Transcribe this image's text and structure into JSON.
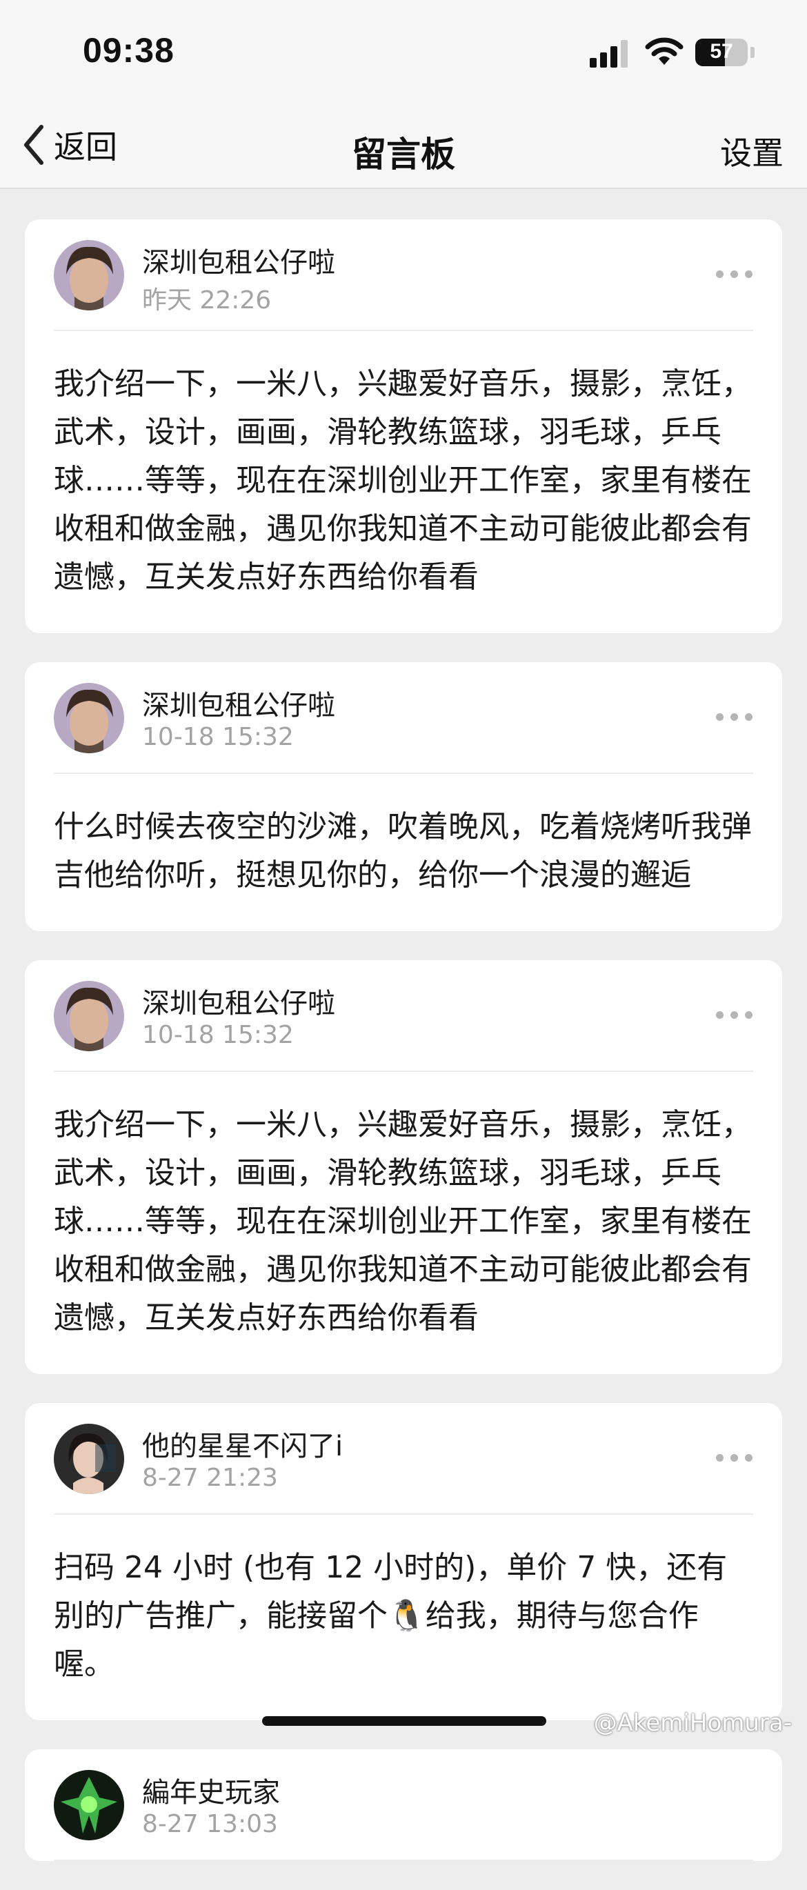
{
  "status": {
    "time": "09:38",
    "battery": "57",
    "battery_level": 0.57
  },
  "nav": {
    "back_label": "返回",
    "title": "留言板",
    "settings_label": "设置"
  },
  "posts": [
    {
      "author": "深圳包租公仔啦",
      "date": "昨天 22:26",
      "content": "我介绍一下，一米八，兴趣爱好音乐，摄影，烹饪，武术，设计，画画，滑轮教练篮球，羽毛球，乒乓球……等等，现在在深圳创业开工作室，家里有楼在收租和做金融，遇见你我知道不主动可能彼此都会有遗憾，互关发点好东西给你看看"
    },
    {
      "author": "深圳包租公仔啦",
      "date": "10-18 15:32",
      "content": "什么时候去夜空的沙滩，吹着晚风，吃着烧烤听我弹吉他给你听，挺想见你的，给你一个浪漫的邂逅"
    },
    {
      "author": "深圳包租公仔啦",
      "date": "10-18 15:32",
      "content": "我介绍一下，一米八，兴趣爱好音乐，摄影，烹饪，武术，设计，画画，滑轮教练篮球，羽毛球，乒乓球……等等，现在在深圳创业开工作室，家里有楼在收租和做金融，遇见你我知道不主动可能彼此都会有遗憾，互关发点好东西给你看看"
    },
    {
      "author": "他的星星不闪了i",
      "date": "8-27 21:23",
      "content_before": "扫码 24 小时 (也有 12 小时的)，单价 7 快，还有别的广告推广，能接留个",
      "emoji": "🐧",
      "content_after": "给我，期待与您合作喔。"
    },
    {
      "author": "編年史玩家",
      "date": "8-27 13:03"
    }
  ],
  "watermark": "@AkemiHomura-"
}
